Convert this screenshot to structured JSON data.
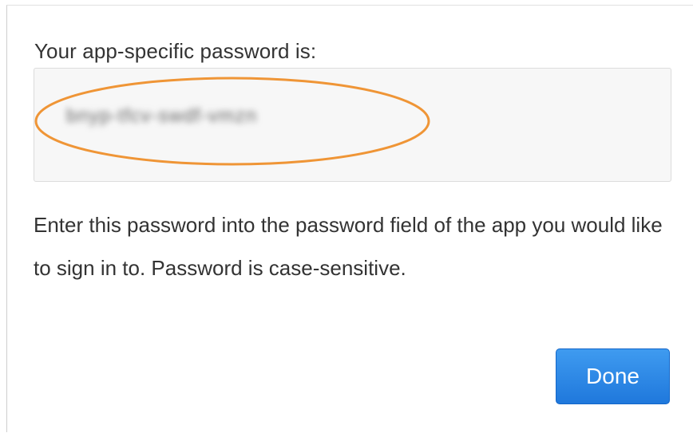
{
  "dialog": {
    "heading": "Your app-specific password is:",
    "password_value": "bnyp-tfcv-swdf-vmzn",
    "description": "Enter this password into the password field of the app you would like to sign in to. Password is case-sensitive.",
    "done_label": "Done"
  },
  "annotation": {
    "ring_color": "#ef9536"
  },
  "colors": {
    "button_blue": "#1f78dc",
    "text": "#333333"
  }
}
